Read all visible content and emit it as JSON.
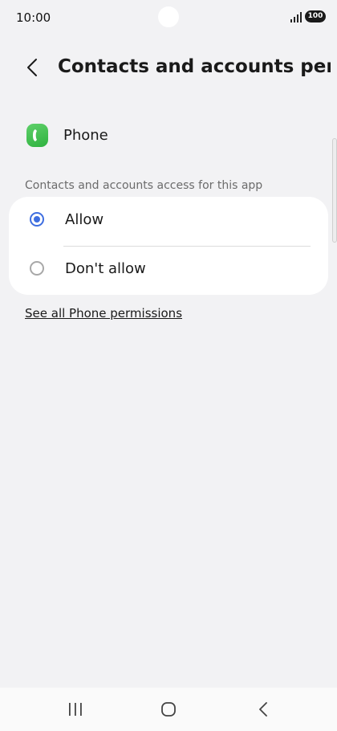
{
  "status_bar": {
    "time": "10:00",
    "battery": "100",
    "icons": [
      "camera-cutout",
      "signal-icon",
      "battery-icon"
    ]
  },
  "header": {
    "title": "Contacts and accounts permi...",
    "back_icon": "chevron-left-icon"
  },
  "app": {
    "name": "Phone",
    "icon": "phone-app-icon",
    "icon_color": "#3db84a"
  },
  "section": {
    "label": "Contacts and accounts access for this app"
  },
  "options": [
    {
      "label": "Allow",
      "selected": true
    },
    {
      "label": "Don't allow",
      "selected": false
    }
  ],
  "link": {
    "label": "See all Phone permissions"
  },
  "nav_bar": {
    "icons": [
      "recents-icon",
      "home-icon",
      "back-icon"
    ]
  },
  "colors": {
    "accent": "#3e6ee0",
    "background": "#f2f2f4",
    "card": "#ffffff"
  }
}
